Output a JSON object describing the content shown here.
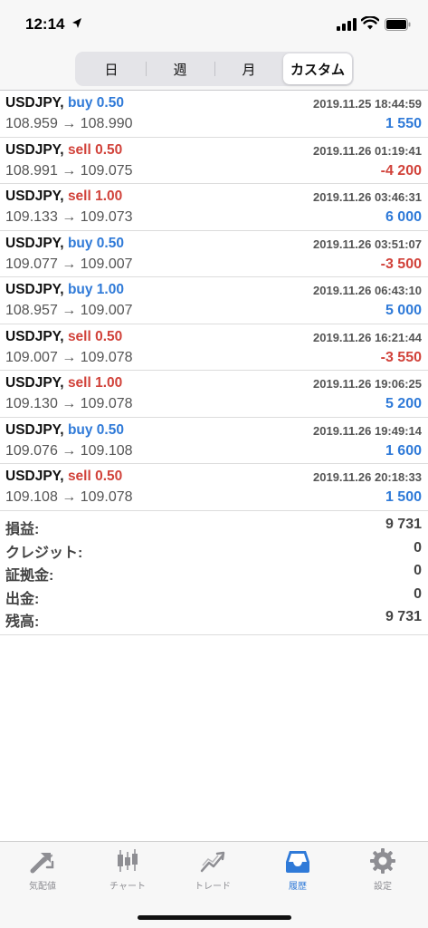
{
  "status_bar": {
    "time": "12:14"
  },
  "period_tabs": [
    {
      "label": "日",
      "active": false
    },
    {
      "label": "週",
      "active": false
    },
    {
      "label": "月",
      "active": false
    },
    {
      "label": "カスタム",
      "active": true
    }
  ],
  "trades": [
    {
      "symbol": "USDJPY,",
      "side": "buy",
      "side_label": "buy 0.50",
      "prices": "108.959 → 108.990",
      "time": "2019.11.25 18:44:59",
      "profit": "1 550"
    },
    {
      "symbol": "USDJPY,",
      "side": "sell",
      "side_label": "sell 0.50",
      "prices": "108.991 → 109.075",
      "time": "2019.11.26 01:19:41",
      "profit": "-4 200"
    },
    {
      "symbol": "USDJPY,",
      "side": "sell",
      "side_label": "sell 1.00",
      "prices": "109.133 → 109.073",
      "time": "2019.11.26 03:46:31",
      "profit": "6 000"
    },
    {
      "symbol": "USDJPY,",
      "side": "buy",
      "side_label": "buy 0.50",
      "prices": "109.077 → 109.007",
      "time": "2019.11.26 03:51:07",
      "profit": "-3 500"
    },
    {
      "symbol": "USDJPY,",
      "side": "buy",
      "side_label": "buy 1.00",
      "prices": "108.957 → 109.007",
      "time": "2019.11.26 06:43:10",
      "profit": "5 000"
    },
    {
      "symbol": "USDJPY,",
      "side": "sell",
      "side_label": "sell 0.50",
      "prices": "109.007 → 109.078",
      "time": "2019.11.26 16:21:44",
      "profit": "-3 550"
    },
    {
      "symbol": "USDJPY,",
      "side": "sell",
      "side_label": "sell 1.00",
      "prices": "109.130 → 109.078",
      "time": "2019.11.26 19:06:25",
      "profit": "5 200"
    },
    {
      "symbol": "USDJPY,",
      "side": "buy",
      "side_label": "buy 0.50",
      "prices": "109.076 → 109.108",
      "time": "2019.11.26 19:49:14",
      "profit": "1 600"
    },
    {
      "symbol": "USDJPY,",
      "side": "sell",
      "side_label": "sell 0.50",
      "prices": "109.108 → 109.078",
      "time": "2019.11.26 20:18:33",
      "profit": "1 500"
    }
  ],
  "summary": [
    {
      "label": "損益:",
      "value": "9 731"
    },
    {
      "label": "クレジット:",
      "value": "0"
    },
    {
      "label": "証拠金:",
      "value": "0"
    },
    {
      "label": "出金:",
      "value": "0"
    },
    {
      "label": "残高:",
      "value": "9 731"
    }
  ],
  "tabbar": [
    {
      "label": "気配値",
      "icon": "quotes-arrows-icon",
      "active": false
    },
    {
      "label": "チャート",
      "icon": "candlestick-chart-icon",
      "active": false
    },
    {
      "label": "トレード",
      "icon": "trade-line-icon",
      "active": false
    },
    {
      "label": "履歴",
      "icon": "history-tray-icon",
      "active": true
    },
    {
      "label": "設定",
      "icon": "gear-icon",
      "active": false
    }
  ],
  "colors": {
    "buy": "#2f7ad8",
    "sell": "#d1423a",
    "profit_positive": "#2f7ad8",
    "profit_negative": "#d1423a",
    "tab_active": "#2f7ad8",
    "tab_inactive": "#8e8e93"
  }
}
